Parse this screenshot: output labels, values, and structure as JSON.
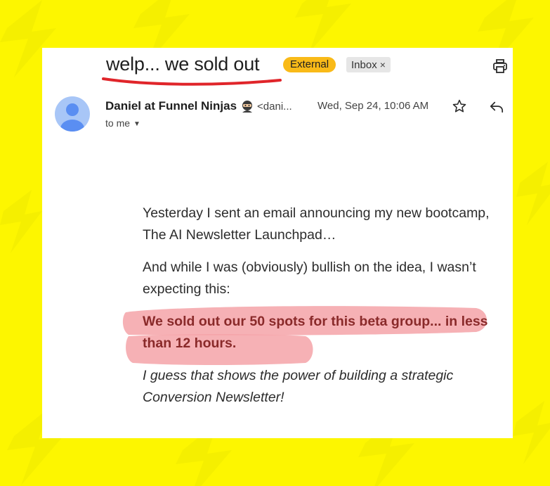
{
  "email": {
    "subject": "welp... we sold out",
    "labels": {
      "external": "External",
      "inbox": "Inbox",
      "inbox_close": "×"
    },
    "sender_name": "Daniel at Funnel Ninjas",
    "sender_email": "<dani...",
    "date": "Wed, Sep 24, 10:06 AM",
    "recipient": "to me",
    "body": {
      "p1": "Yesterday I sent an email announcing my new bootcamp, The AI Newsletter Launchpad…",
      "p2": "And while I was (obviously) bullish on the idea, I wasn’t expecting this:",
      "p3": "We sold out our 50 spots for this beta group... in less than 12 hours.",
      "p4": "I guess that shows the power of building a strategic Conversion Newsletter!"
    }
  },
  "icons": [
    "print-icon",
    "avatar-icon",
    "ninja-icon",
    "star-icon",
    "reply-icon",
    "chevron-down-icon"
  ],
  "colors": {
    "background": "#fdf600",
    "external_badge": "#f9ba18",
    "highlight": "#f4a3a8",
    "underline": "#e0252a",
    "avatar": "#5a8ef2"
  }
}
